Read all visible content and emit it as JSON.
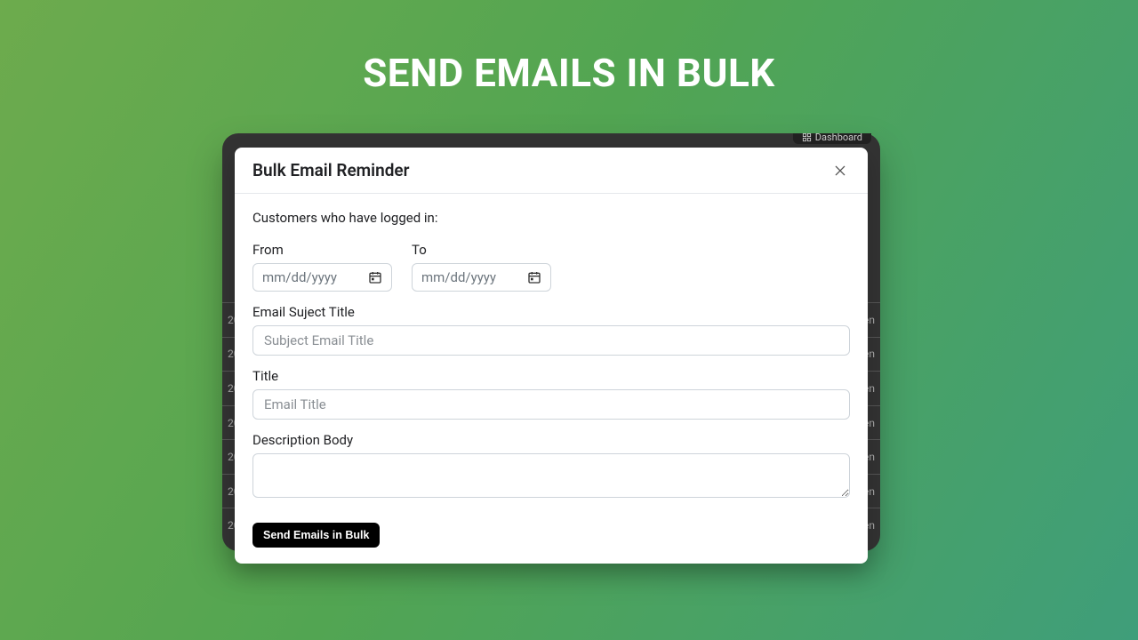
{
  "hero": {
    "title": "SEND EMAILS IN BULK"
  },
  "backdrop": {
    "dashboard_label": "Dashboard",
    "row_left": "20",
    "row_right": "len"
  },
  "modal": {
    "title": "Bulk Email Reminder",
    "helper": "Customers who have logged in:",
    "from_label": "From",
    "to_label": "To",
    "date_placeholder": "mm/dd/yyyy",
    "subject_label": "Email Suject Title",
    "subject_placeholder": "Subject Email Title",
    "title_label": "Title",
    "title_placeholder": "Email Title",
    "body_label": "Description Body",
    "send_label": "Send Emails in Bulk"
  }
}
